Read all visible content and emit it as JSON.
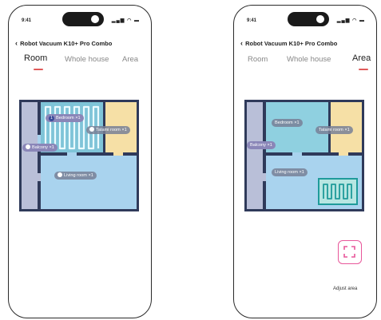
{
  "status": {
    "time": "9:41"
  },
  "header": {
    "title": "Robot Vacuum K10+ Pro Combo"
  },
  "left": {
    "tabs": [
      {
        "label": "Room"
      },
      {
        "label": "Whole house"
      },
      {
        "label": "Area"
      }
    ],
    "active_tab": "Room",
    "rooms": {
      "bedroom_num": "1",
      "bedroom": "Bedroom ×1",
      "tatami": "Tatami room ×1",
      "balcony": "Balcony ×1",
      "living": "Living room ×1"
    }
  },
  "right": {
    "tabs": [
      {
        "label": "Room"
      },
      {
        "label": "Whole house"
      },
      {
        "label": "Area"
      }
    ],
    "active_tab": "Area",
    "rooms": {
      "bedroom": "Bedroom ×1",
      "tatami": "Tatami room ×1",
      "balcony": "Balcony ×1",
      "living": "Living room ×1"
    },
    "adjust_area_label": "Adjust area"
  },
  "colors": {
    "accent": "#e05a5a",
    "adjust_border": "#e8579a",
    "bedroom": "#7fc4d8",
    "tatami": "#f6e0a6",
    "living": "#a9d3ee",
    "corridor": "#b9bfd8",
    "wall": "#2f3a5a",
    "area_box": "#1f9b9a"
  },
  "icons": [
    "back-chevron-icon",
    "signal-icon",
    "wifi-icon",
    "battery-icon",
    "check-icon",
    "adjust-area-icon"
  ]
}
